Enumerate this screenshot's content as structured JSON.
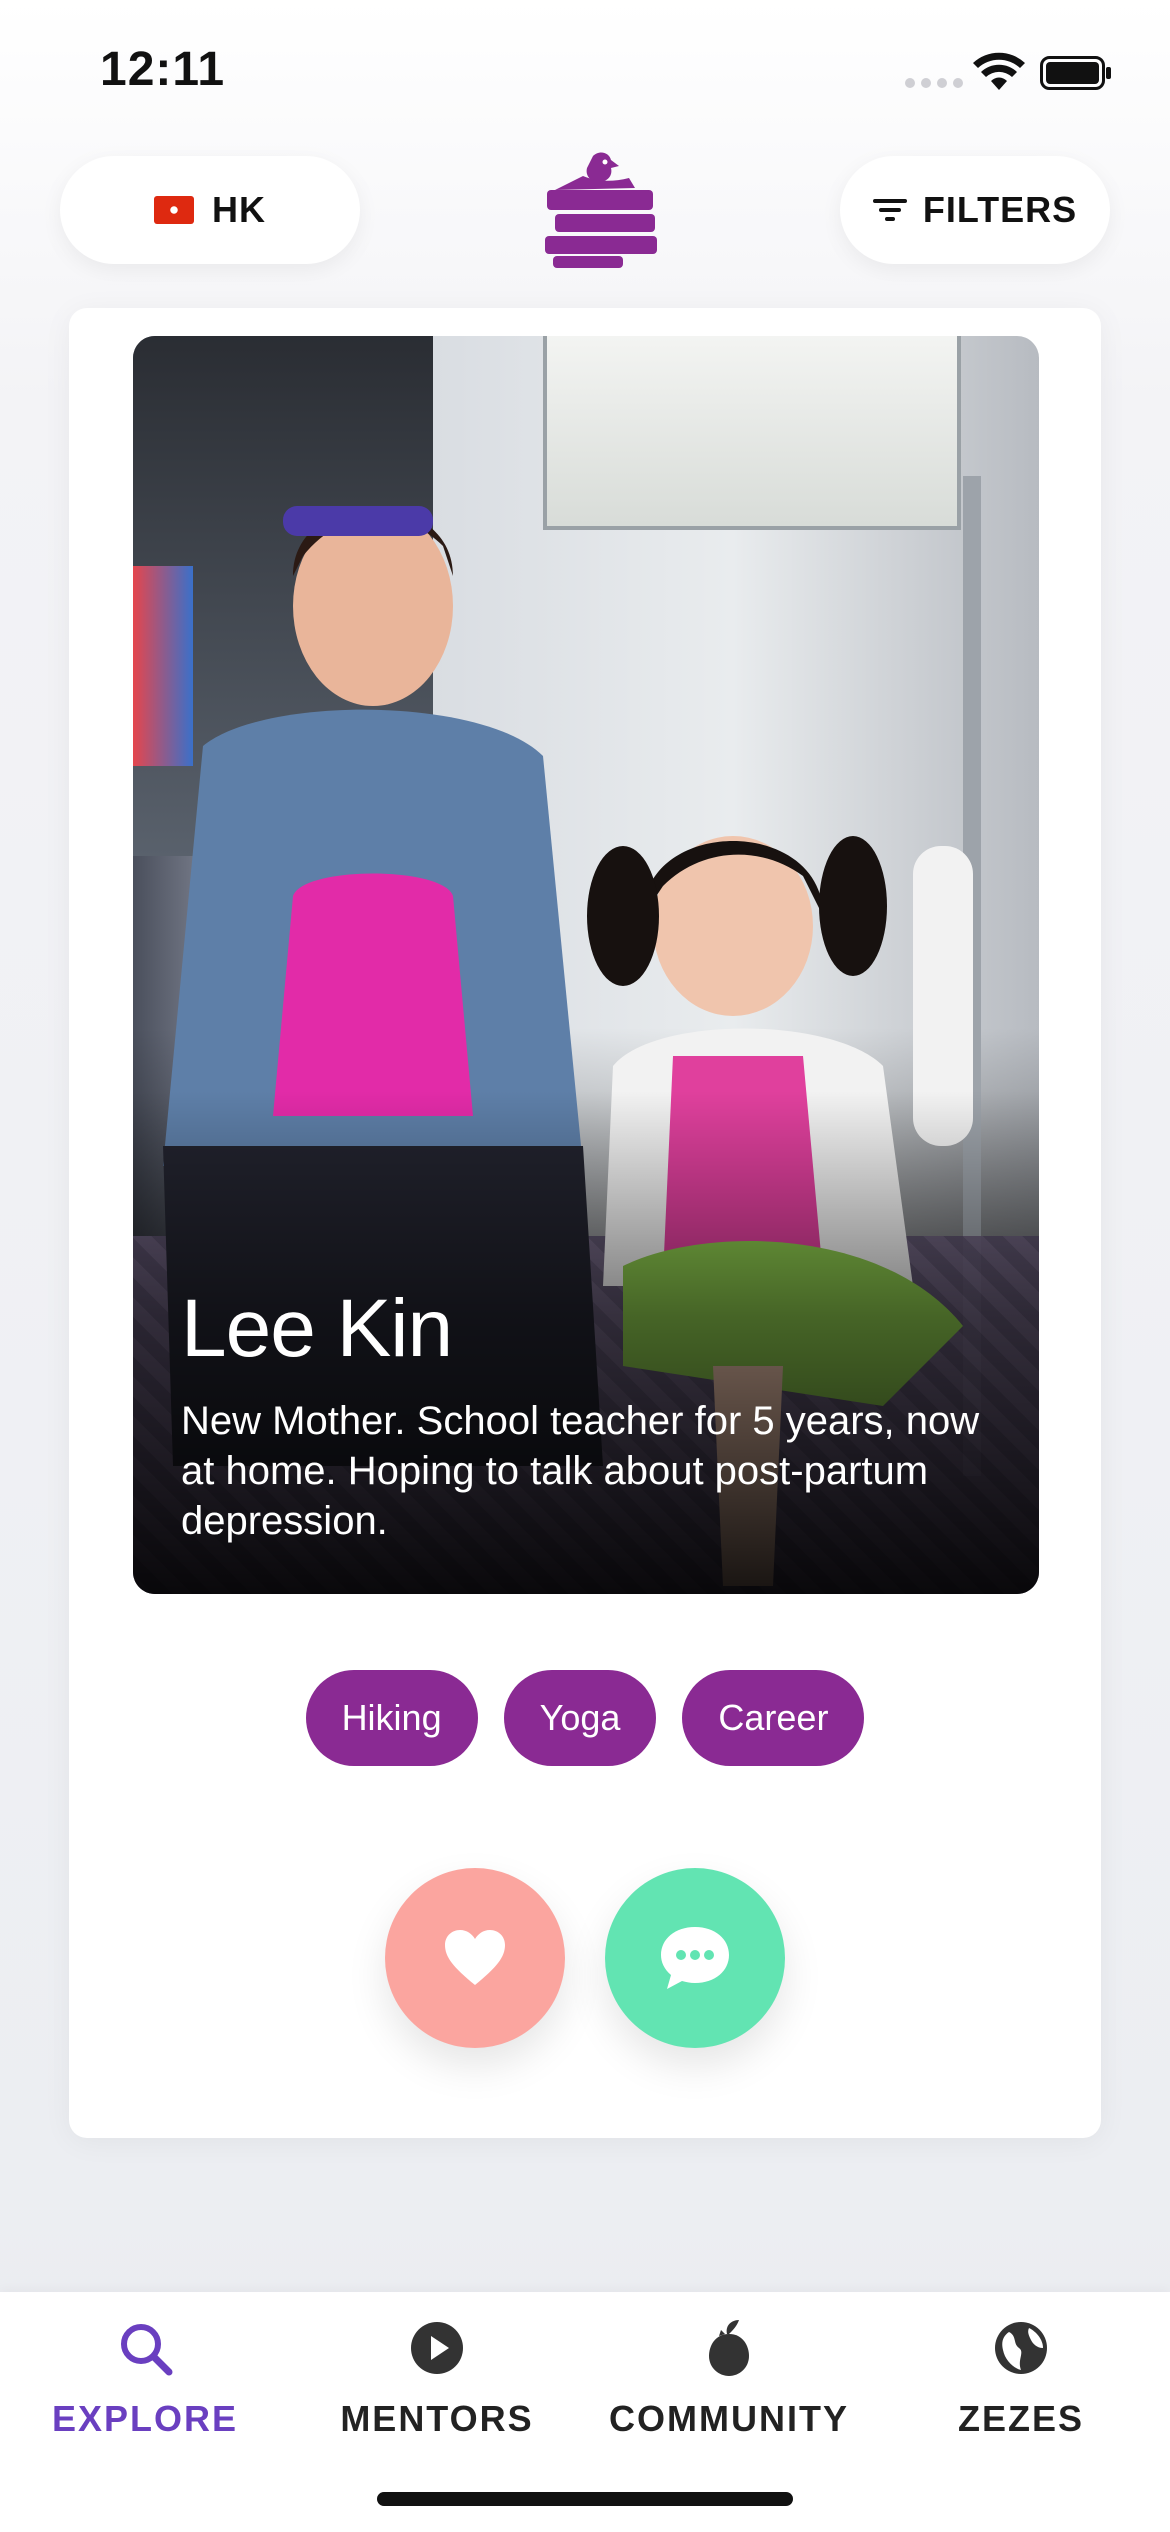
{
  "status_bar": {
    "time": "12:11"
  },
  "header": {
    "region_label": "HK",
    "filters_label": "FILTERS"
  },
  "profile": {
    "name": "Lee Kin",
    "bio": "New Mother. School teacher for 5 years, now at home. Hoping to talk about post-partum depression.",
    "tags": [
      "Hiking",
      "Yoga",
      "Career"
    ]
  },
  "actions": {
    "like_icon": "heart-icon",
    "chat_icon": "chat-bubble-icon"
  },
  "tab_bar": {
    "tabs": [
      {
        "label": "EXPLORE",
        "icon": "search-icon",
        "active": true
      },
      {
        "label": "MENTORS",
        "icon": "play-icon",
        "active": false
      },
      {
        "label": "COMMUNITY",
        "icon": "community-icon",
        "active": false
      },
      {
        "label": "ZEZES",
        "icon": "globe-icon",
        "active": false
      }
    ]
  },
  "colors": {
    "brand_purple": "#8a2a93",
    "active_tab": "#6a3fc0",
    "like_button": "#fba59f",
    "chat_button": "#62e4b2"
  }
}
